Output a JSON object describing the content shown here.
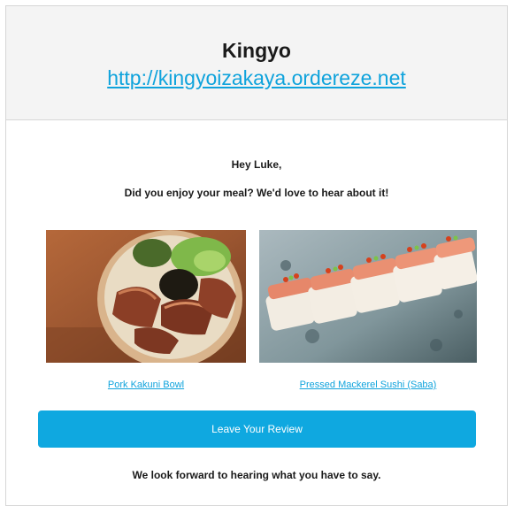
{
  "header": {
    "store_name": "Kingyo",
    "store_url": "http://kingyoizakaya.ordereze.net"
  },
  "body": {
    "greeting": "Hey Luke,",
    "intro": "Did you enjoy your meal? We'd love to hear about it!",
    "closing": "We look forward to hearing what you have to say."
  },
  "items": [
    {
      "name": "Pork Kakuni Bowl"
    },
    {
      "name": "Pressed Mackerel Sushi (Saba)"
    }
  ],
  "cta": {
    "label": "Leave Your Review"
  },
  "colors": {
    "link": "#0fa3dc",
    "button": "#0fa8e0",
    "header_bg": "#f4f4f4"
  }
}
